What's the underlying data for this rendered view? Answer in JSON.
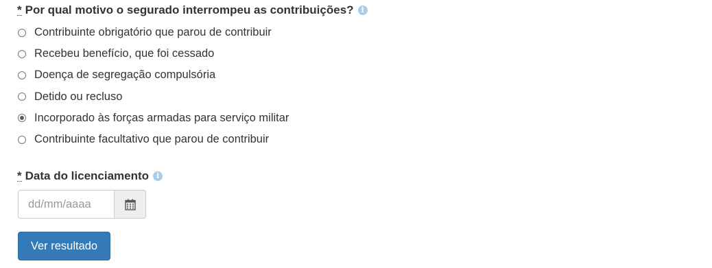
{
  "question1": {
    "required_mark": "*",
    "label": "Por qual motivo o segurado interrompeu as contribuições?",
    "info_icon": "info-circle-icon",
    "options": [
      {
        "label": "Contribuinte obrigatório que parou de contribuir",
        "selected": false
      },
      {
        "label": "Recebeu benefício, que foi cessado",
        "selected": false
      },
      {
        "label": "Doença de segregação compulsória",
        "selected": false
      },
      {
        "label": "Detido ou recluso",
        "selected": false
      },
      {
        "label": "Incorporado às forças armadas para serviço militar",
        "selected": true
      },
      {
        "label": "Contribuinte facultativo que parou de contribuir",
        "selected": false
      }
    ]
  },
  "question2": {
    "required_mark": "*",
    "label": "Data do licenciamento",
    "info_icon": "info-circle-icon",
    "input": {
      "value": "",
      "placeholder": "dd/mm/aaaa"
    },
    "calendar_icon": "calendar-icon"
  },
  "submit": {
    "label": "Ver resultado"
  },
  "colors": {
    "primary_button": "#337ab7",
    "info_icon": "#a9cce8",
    "text": "#333333"
  }
}
